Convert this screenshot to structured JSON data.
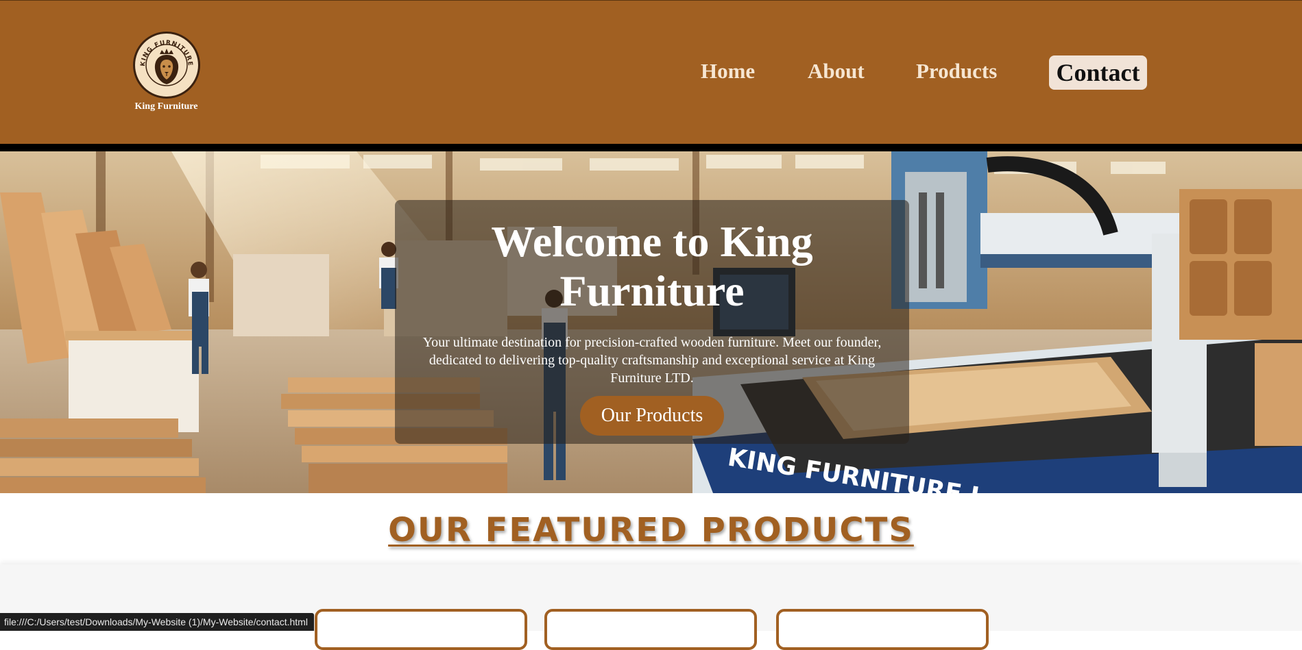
{
  "brand": {
    "name": "King Furniture",
    "logo_text": "KING FURNITURE"
  },
  "nav": {
    "home": "Home",
    "about": "About",
    "products": "Products",
    "contact": "Contact"
  },
  "hero": {
    "title": "Welcome to King Furniture",
    "text": "Your ultimate destination for precision-crafted wooden furniture. Meet our founder, dedicated to delivering top-quality craftsmanship and exceptional service at King Furniture LTD.",
    "button": "Our Products",
    "machine_label": "KING FURNITURE L"
  },
  "featured": {
    "title": "OUR FEATURED PRODUCTS"
  },
  "statusbar": {
    "url": "file:///C:/Users/test/Downloads/My-Website (1)/My-Website/contact.html"
  },
  "colors": {
    "brand": "#a16022",
    "contact_bg": "#f1e3d7",
    "nav_text": "#f6e6d2"
  }
}
